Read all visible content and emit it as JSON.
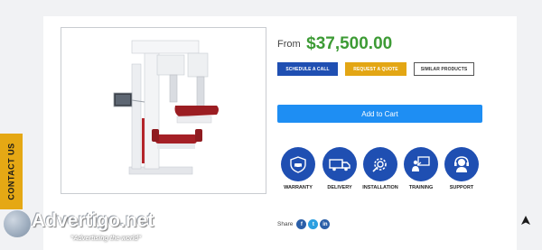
{
  "price": {
    "from_label": "From",
    "amount": "$37,500.00"
  },
  "actions": {
    "schedule_label": "SCHEDULE A CALL",
    "quote_label": "REQUEST A QUOTE",
    "similar_label": "SIMILAR PRODUCTS"
  },
  "cart": {
    "label": "Add to Cart"
  },
  "features": [
    {
      "label": "WARRANTY",
      "icon": "warranty-car-icon"
    },
    {
      "label": "DELIVERY",
      "icon": "truck-icon"
    },
    {
      "label": "INSTALLATION",
      "icon": "installation-gear-icon"
    },
    {
      "label": "TRAINING",
      "icon": "training-icon"
    },
    {
      "label": "SUPPORT",
      "icon": "support-headset-icon"
    }
  ],
  "share": {
    "label": "Share",
    "networks": [
      "f",
      "t",
      "in"
    ]
  },
  "contact_tab": {
    "label": "CONTACT US"
  },
  "watermark": {
    "name": "Advertigo.net",
    "slogan": "\"Advertising  the world\""
  },
  "colors": {
    "primary_blue": "#1f4fb2",
    "cart_blue": "#1e8ef3",
    "price_green": "#3d9b35",
    "accent_yellow": "#e5a814"
  }
}
